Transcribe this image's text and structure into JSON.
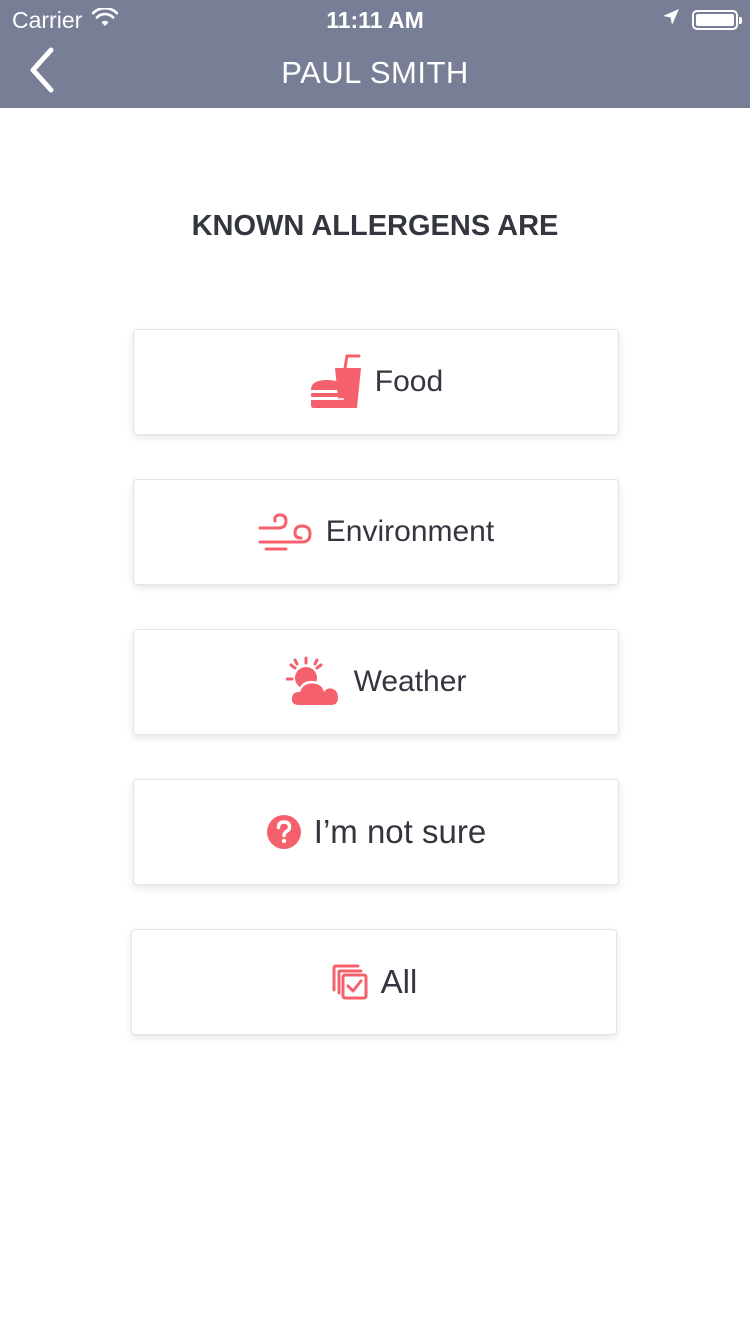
{
  "status_bar": {
    "carrier": "Carrier",
    "time": "11:11 AM",
    "icons": [
      "wifi-icon",
      "location-arrow-icon",
      "battery-icon"
    ]
  },
  "nav": {
    "title": "PAUL SMITH",
    "back_icon": "chevron-left-icon"
  },
  "heading": "KNOWN ALLERGENS ARE",
  "colors": {
    "nav_bar": "#777e96",
    "accent": "#f4606c",
    "text": "#33363f"
  },
  "options": [
    {
      "label": "Food",
      "icon": "food-drink-icon"
    },
    {
      "label": "Environment",
      "icon": "wind-icon"
    },
    {
      "label": "Weather",
      "icon": "sun-cloud-icon"
    },
    {
      "label": "I’m not sure",
      "icon": "question-circle-icon"
    },
    {
      "label": "All",
      "icon": "checkbox-stack-icon"
    }
  ]
}
